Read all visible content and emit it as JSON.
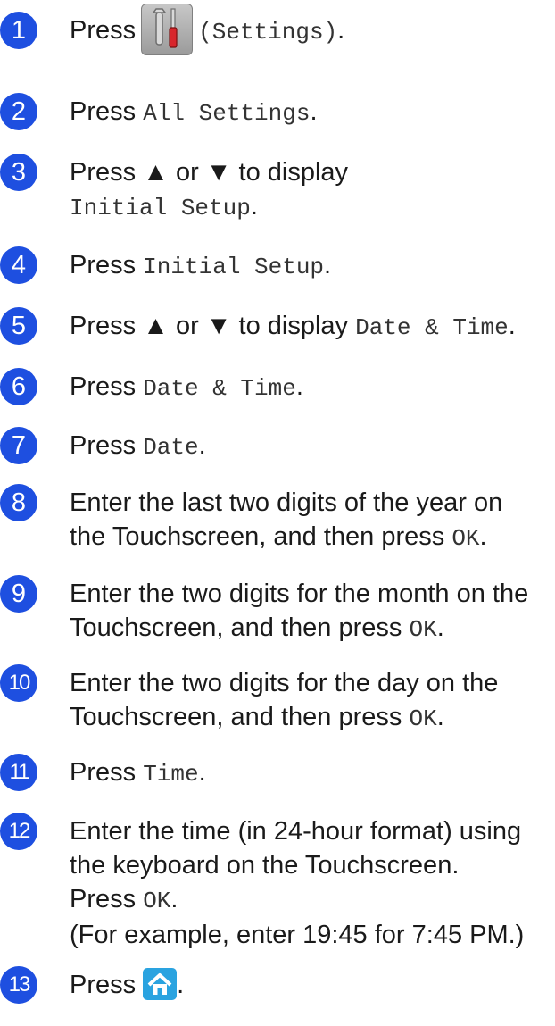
{
  "steps": [
    {
      "num": "1",
      "parts": [
        "Press",
        "(Settings)",
        "."
      ]
    },
    {
      "num": "2",
      "parts": [
        "Press",
        "All Settings",
        "."
      ]
    },
    {
      "num": "3",
      "parts": [
        "Press ▲ or ▼ to display",
        "Initial Setup",
        "."
      ]
    },
    {
      "num": "4",
      "parts": [
        "Press",
        "Initial Setup",
        "."
      ]
    },
    {
      "num": "5",
      "parts": [
        "Press ▲ or ▼ to display",
        "Date & Time",
        "."
      ]
    },
    {
      "num": "6",
      "parts": [
        "Press",
        "Date & Time",
        "."
      ]
    },
    {
      "num": "7",
      "parts": [
        "Press",
        "Date",
        "."
      ]
    },
    {
      "num": "8",
      "parts": [
        "Enter the last two digits of the year on",
        "the Touchscreen, and then press",
        "OK",
        "."
      ]
    },
    {
      "num": "9",
      "parts": [
        "Enter the two digits for the month on the",
        "Touchscreen, and then press",
        "OK",
        "."
      ]
    },
    {
      "num": "10",
      "parts": [
        "Enter the two digits for the day on the",
        "Touchscreen, and then press",
        "OK",
        "."
      ]
    },
    {
      "num": "11",
      "parts": [
        "Press",
        "Time",
        "."
      ]
    },
    {
      "num": "12",
      "parts": [
        "Enter the time (in 24-hour format) using",
        "the keyboard on the Touchscreen.",
        "Press",
        "OK",
        ".",
        "(For example, enter 19:45 for 7:45 PM.)"
      ]
    },
    {
      "num": "13",
      "parts": [
        "Press",
        "."
      ]
    }
  ],
  "icons": {
    "settings": "settings-tools-icon",
    "home": "home-icon"
  },
  "colors": {
    "step_badge": "#1e4fe0",
    "home_icon": "#2aa3e0"
  }
}
